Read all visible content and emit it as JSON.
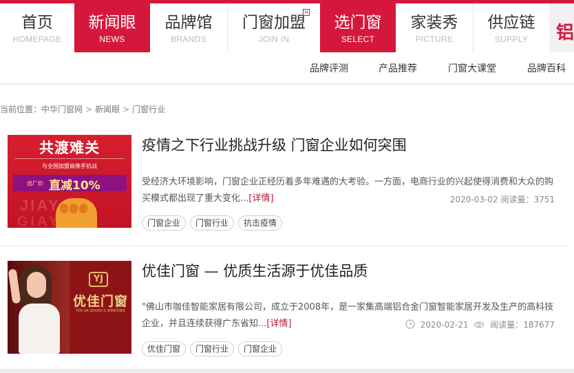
{
  "nav": {
    "items": [
      {
        "zh": "首页",
        "en": "HOMEPAGE"
      },
      {
        "zh": "新闻眼",
        "en": "NEWS"
      },
      {
        "zh": "品牌馆",
        "en": "BRANDS"
      },
      {
        "zh": "门窗加盟",
        "en": "JOIN IN"
      },
      {
        "zh": "选门窗",
        "en": "SELECT"
      },
      {
        "zh": "家装秀",
        "en": "PICTURE"
      },
      {
        "zh": "供应链",
        "en": "SUPPLY"
      }
    ],
    "join_badge": "H",
    "logo_char": "铝",
    "accent_color": "#d6173c"
  },
  "subnav": {
    "items": [
      "品牌评测",
      "产品推荐",
      "门窗大课堂",
      "品牌百科"
    ]
  },
  "breadcrumb": {
    "label": "当前位置：",
    "items": [
      "中华门窗网",
      "新闻眼",
      "门窗行业"
    ],
    "separator": ">"
  },
  "articles": [
    {
      "title": "疫情之下行业挑战升级 门窗企业如何突围",
      "summary": "受经济大环境影响，门窗企业正经历着多年难遇的大考验。一方面，电商行业的兴起使得消费和大众的购买模式都出现了重大变化...",
      "more": "[详情]",
      "date": "2020-03-02",
      "views_label": "阅读量：",
      "views": "3751",
      "tags": [
        "门窗企业",
        "门窗行业",
        "抗击疫情"
      ],
      "image": {
        "headline": "共渡难关",
        "subline": "与全国加盟商携手抗战",
        "band_prefix": "出厂价",
        "band_text": "直减10%",
        "watermark1": "JIAYOU",
        "watermark2": "GIAYOU"
      }
    },
    {
      "title": "优佳门窗 — 优质生活源于优佳品质",
      "summary": "\"佛山市咖佳智能家居有限公司，成立于2008年，是一家集高端铝合金门窗智能家居开发及生产的高科技企业，并且连续获得广东省知...",
      "more": "[详情]",
      "date": "2020-02-21",
      "views_label": "阅读量：",
      "views": "187677",
      "tags": [
        "优佳门窗",
        "门窗行业",
        "门窗企业"
      ],
      "image": {
        "logo_mark": "YJ",
        "logo_text": "优佳门窗",
        "logo_en": "YOU JIA DOORS & WINDOWS"
      }
    }
  ]
}
